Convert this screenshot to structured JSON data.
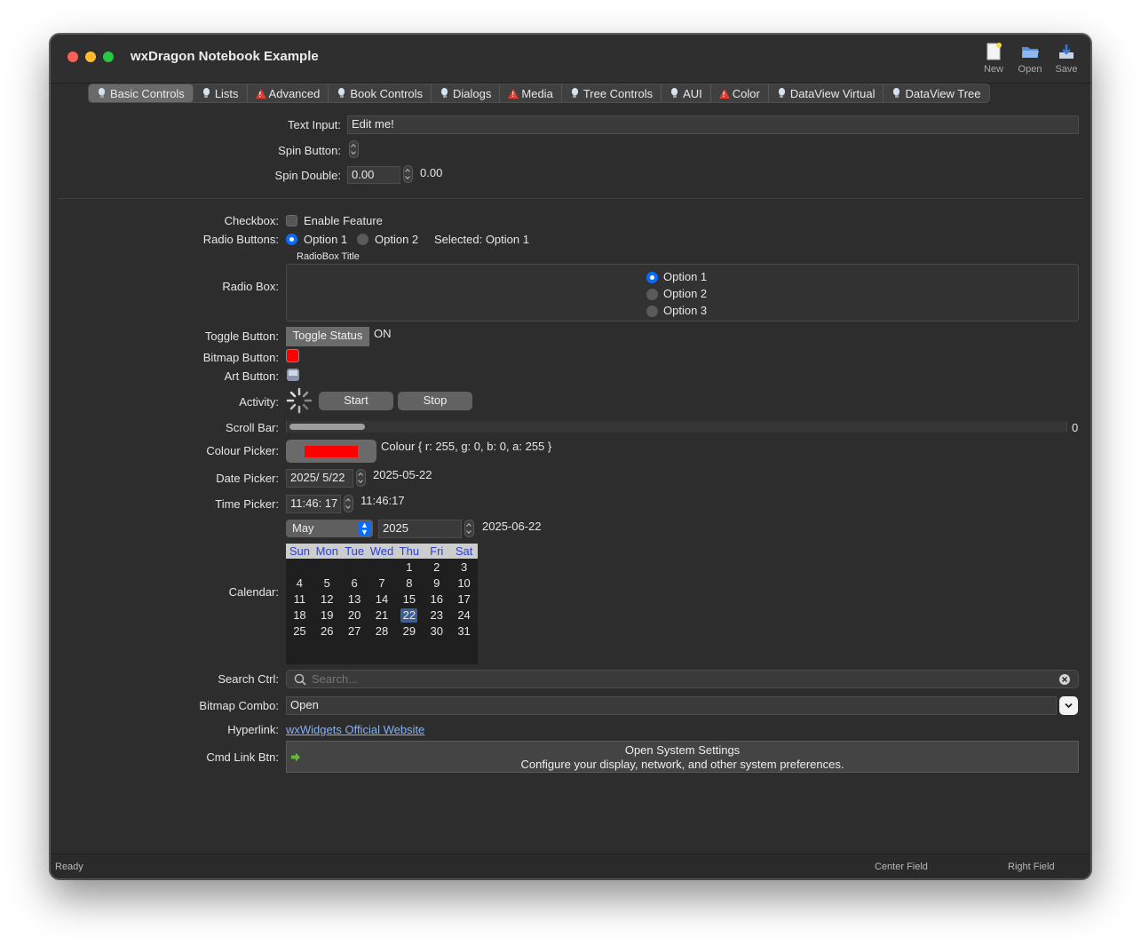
{
  "window": {
    "title": "wxDragon Notebook Example"
  },
  "toolbar": {
    "new_label": "New",
    "open_label": "Open",
    "save_label": "Save"
  },
  "tabs": [
    {
      "label": "Basic Controls",
      "icon": "bulb-icon",
      "active": true
    },
    {
      "label": "Lists",
      "icon": "bulb-icon"
    },
    {
      "label": "Advanced",
      "icon": "warning-icon"
    },
    {
      "label": "Book Controls",
      "icon": "bulb-icon"
    },
    {
      "label": "Dialogs",
      "icon": "bulb-icon"
    },
    {
      "label": "Media",
      "icon": "warning-icon"
    },
    {
      "label": "Tree Controls",
      "icon": "bulb-icon"
    },
    {
      "label": "AUI",
      "icon": "bulb-icon"
    },
    {
      "label": "Color",
      "icon": "warning-icon"
    },
    {
      "label": "DataView Virtual",
      "icon": "bulb-icon"
    },
    {
      "label": "DataView Tree",
      "icon": "bulb-icon"
    }
  ],
  "form": {
    "text_input_label": "Text Input:",
    "text_input_value": "Edit me!",
    "spin_button_label": "Spin Button:",
    "spin_double_label": "Spin Double:",
    "spin_double_value": "0.00",
    "spin_double_readout": "0.00",
    "checkbox_label": "Checkbox:",
    "checkbox_text": "Enable Feature",
    "radio_buttons_label": "Radio Buttons:",
    "radio_option1": "Option 1",
    "radio_option2": "Option 2",
    "radio_selected": "Selected: Option 1",
    "radiobox_title": "RadioBox Title",
    "radiobox_label": "Radio Box:",
    "radiobox_options": [
      "Option 1",
      "Option 2",
      "Option 3"
    ],
    "toggle_label": "Toggle Button:",
    "toggle_text": "Toggle Status",
    "toggle_state": "ON",
    "bitmap_button_label": "Bitmap Button:",
    "art_button_label": "Art Button:",
    "activity_label": "Activity:",
    "start_label": "Start",
    "stop_label": "Stop",
    "scrollbar_label": "Scroll Bar:",
    "scrollbar_value": "0",
    "colour_picker_label": "Colour Picker:",
    "colour_value": "#ff0000",
    "colour_text": "Colour { r: 255, g: 0, b: 0, a: 255 }",
    "date_picker_label": "Date Picker:",
    "date_value": "2025/ 5/22",
    "date_readout": "2025-05-22",
    "time_picker_label": "Time Picker:",
    "time_value": "11:46: 17",
    "time_readout": "11:46:17",
    "calendar_label": "Calendar:",
    "calendar_month": "May",
    "calendar_year": "2025",
    "calendar_readout": "2025-06-22",
    "calendar_days_header": [
      "Sun",
      "Mon",
      "Tue",
      "Wed",
      "Thu",
      "Fri",
      "Sat"
    ],
    "calendar_weeks": [
      [
        "",
        "",
        "",
        "",
        "1",
        "2",
        "3"
      ],
      [
        "4",
        "5",
        "6",
        "7",
        "8",
        "9",
        "10"
      ],
      [
        "11",
        "12",
        "13",
        "14",
        "15",
        "16",
        "17"
      ],
      [
        "18",
        "19",
        "20",
        "21",
        "22",
        "23",
        "24"
      ],
      [
        "25",
        "26",
        "27",
        "28",
        "29",
        "30",
        "31"
      ]
    ],
    "calendar_selected_day": "22",
    "search_label": "Search Ctrl:",
    "search_placeholder": "Search...",
    "bitmap_combo_label": "Bitmap Combo:",
    "bitmap_combo_value": "Open",
    "hyperlink_label": "Hyperlink:",
    "hyperlink_text": "wxWidgets Official Website",
    "cmd_link_label": "Cmd Link Btn:",
    "cmd_link_title": "Open System Settings",
    "cmd_link_note": "Configure your display, network, and other system preferences."
  },
  "status": {
    "left": "Ready",
    "center": "Center Field",
    "right": "Right Field"
  },
  "colors": {
    "accent": "#0a6cff",
    "link": "#7fb2ff",
    "window_bg": "#2d2d2d"
  }
}
